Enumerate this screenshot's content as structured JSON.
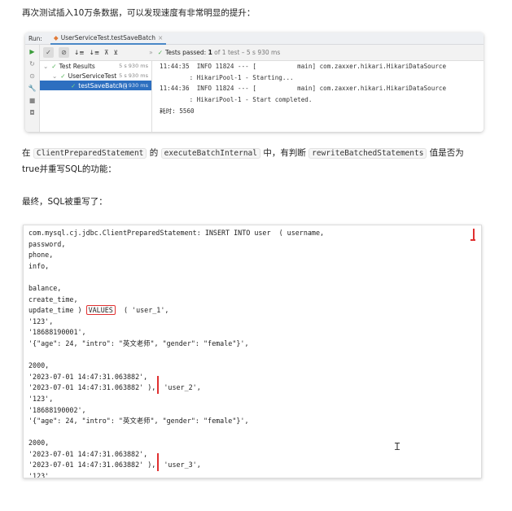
{
  "intro": "再次测试插入10万条数据，可以发现速度有非常明显的提升：",
  "ide": {
    "run_label": "Run:",
    "tab_label": "UserServiceTest.testSaveBatch",
    "status_prefix": "Tests passed: ",
    "status_count": "1",
    "status_suffix": " of 1 test – 5 s 930 ms",
    "tree": [
      {
        "label": "Test Results",
        "time": "5 s 930 ms"
      },
      {
        "label": "UserServiceTest",
        "time": "5 s 930 ms"
      },
      {
        "label": "testSaveBatch()",
        "time": "5 s 930 ms"
      }
    ],
    "console": [
      "11:44:35  INFO 11824 --- [           main] com.zaxxer.hikari.HikariDataSource",
      "        : HikariPool-1 - Starting...",
      "11:44:36  INFO 11824 --- [           main] com.zaxxer.hikari.HikariDataSource",
      "        : HikariPool-1 - Start completed.",
      "耗时: 5560"
    ]
  },
  "para": {
    "a": "在 ",
    "c1": "ClientPreparedStatement",
    "b": " 的 ",
    "c2": "executeBatchInternal",
    "c": " 中，有判断 ",
    "c3": "rewriteBatchedStatements",
    "d": " 值是否为",
    "line2": "true并重写SQL的功能："
  },
  "final": "最终，SQL被重写了：",
  "code": {
    "before": [
      "com.mysql.cj.jdbc.ClientPreparedStatement: INSERT INTO user  ( username,",
      "password,",
      "phone,",
      "info,",
      "",
      "balance,",
      "create_time,"
    ],
    "values_prefix": "update_time ) ",
    "values_kw": "VALUES",
    "values_suffix": "  ( 'user_1',",
    "after": [
      "'123',",
      "'18688190001',",
      "'{\"age\": 24, \"intro\": \"英文老师\", \"gender\": \"female\"}',",
      "",
      "2000,",
      "'2023-07-01 14:47:31.063882',",
      "'2023-07-01 14:47:31.063882' ),( 'user_2',",
      "'123',",
      "'18688190002',",
      "'{\"age\": 24, \"intro\": \"英文老师\", \"gender\": \"female\"}',",
      "",
      "2000,",
      "'2023-07-01 14:47:31.063882',",
      "'2023-07-01 14:47:31.063882' ),( 'user_3',",
      "'123'"
    ]
  }
}
